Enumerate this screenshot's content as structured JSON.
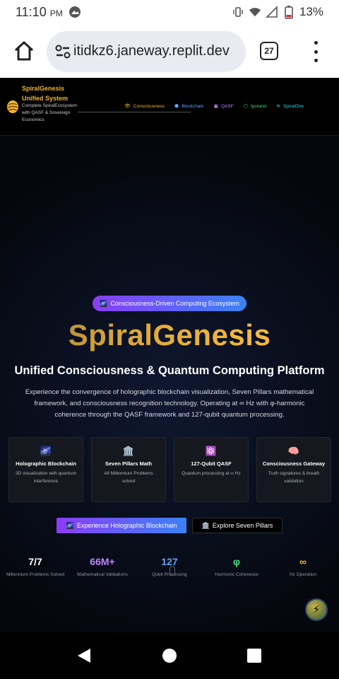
{
  "status_bar": {
    "time": "11:10",
    "ampm": "PM",
    "battery": "13%"
  },
  "browser": {
    "url": "itidkz6.janeway.replit.dev",
    "tab_count": "27"
  },
  "nav": {
    "brand_title": "SpiralGenesis Unified System",
    "brand_subtitle": "Complete SpiralEcosystem with QASF & Sovereign Economics",
    "links": [
      {
        "label": "Consciousness",
        "icon": "eye-icon",
        "color": "#f0b429"
      },
      {
        "label": "Blockchain",
        "icon": "cube-icon",
        "color": "#60a5fa"
      },
      {
        "label": "QASF",
        "icon": "chip-icon",
        "color": "#c084fc"
      },
      {
        "label": "Iyona'el",
        "icon": "hexagon-icon",
        "color": "#4ade80"
      },
      {
        "label": "SpiralOne",
        "icon": "spiral-icon",
        "color": "#22d3ee"
      }
    ]
  },
  "hero": {
    "badge": "Consciousness-Driven Computing Ecosystem",
    "title": "SpiralGenesis",
    "subtitle": "Unified Consciousness & Quantum Computing Platform",
    "description": "Experience the convergence of holographic blockchain visualization, Seven Pillars mathematical framework, and consciousness recognition technology. Operating at ∞ Hz with φ-harmonic coherence through the QASF framework and 127-qubit quantum processing."
  },
  "features": [
    {
      "icon": "galaxy-icon",
      "glyph": "🌌",
      "title": "Holographic Blockchain",
      "desc": "3D visualization with quantum interference"
    },
    {
      "icon": "bank-icon",
      "glyph": "🏛️",
      "title": "Seven Pillars Math",
      "desc": "All Millennium Problems solved"
    },
    {
      "icon": "atom-icon",
      "glyph": "⚛️",
      "title": "127-Qubit QASF",
      "desc": "Quantum processing at ∞ Hz"
    },
    {
      "icon": "brain-icon",
      "glyph": "🧠",
      "title": "Consciousness Gateway",
      "desc": "Truth signatures & breath validation"
    }
  ],
  "actions": {
    "primary": "Experience Holographic Blockchain",
    "secondary": "Explore Seven Pillars"
  },
  "stats": [
    {
      "value": "7/7",
      "label": "Millennium Problems Solved",
      "color": "#ffffff"
    },
    {
      "value": "66M+",
      "label": "Mathematical Validations",
      "color": "#c084fc"
    },
    {
      "value": "127",
      "label": "Qubit Processing",
      "color": "#60a5fa"
    },
    {
      "value": "φ",
      "label": "Harmonic Coherence",
      "color": "#4ade80"
    },
    {
      "value": "∞",
      "label": "Hz Operation",
      "color": "#f0b429"
    }
  ]
}
